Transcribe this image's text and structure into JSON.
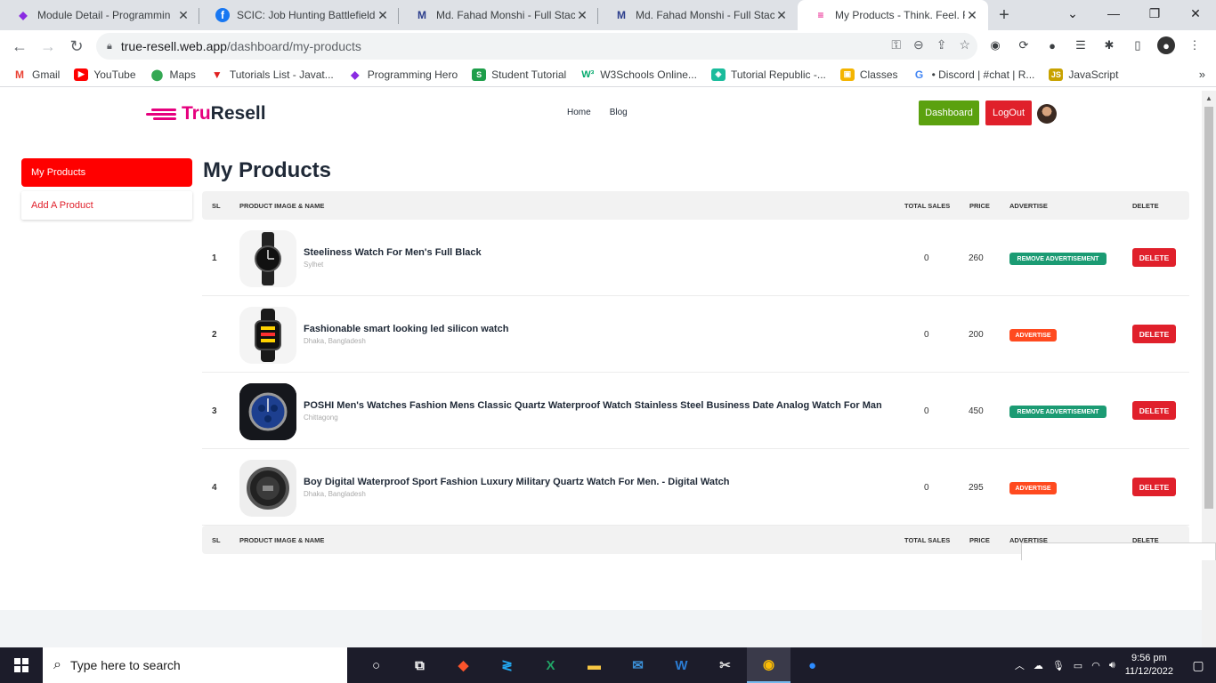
{
  "browser": {
    "tabs": [
      {
        "title": "Module Detail - Programmin",
        "favicon_color": "#8a2be2",
        "favicon": "◆",
        "active": false
      },
      {
        "title": "SCIC: Job Hunting Battlefield",
        "favicon_color": "#1877f2",
        "favicon": "f",
        "active": false
      },
      {
        "title": "Md. Fahad Monshi - Full Stac",
        "favicon_color": "#2c3e8c",
        "favicon": "M",
        "active": false
      },
      {
        "title": "Md. Fahad Monshi - Full Stac",
        "favicon_color": "#2c3e8c",
        "favicon": "M",
        "active": false
      },
      {
        "title": "My Products - Think. Feel. Re",
        "favicon_color": "#e6007e",
        "favicon": "≡",
        "active": true
      }
    ],
    "url_host": "true-resell.web.app",
    "url_path": "/dashboard/my-products",
    "bookmarks": [
      {
        "label": "Gmail",
        "icon_color": "#ea4335",
        "icon": "M"
      },
      {
        "label": "YouTube",
        "icon_color": "#ff0000",
        "icon": "▶"
      },
      {
        "label": "Maps",
        "icon_color": "#34a853",
        "icon": "●"
      },
      {
        "label": "Tutorials List - Javat...",
        "icon_color": "#e02020",
        "icon": "▼"
      },
      {
        "label": "Programming Hero",
        "icon_color": "#8a2be2",
        "icon": "◆"
      },
      {
        "label": "Student Tutorial",
        "icon_color": "#1e9e4a",
        "icon": "S"
      },
      {
        "label": "W3Schools Online...",
        "icon_color": "#04aa6d",
        "icon": "W"
      },
      {
        "label": "Tutorial Republic -...",
        "icon_color": "#1abc9c",
        "icon": "◈"
      },
      {
        "label": "Classes",
        "icon_color": "#f4b400",
        "icon": "▣"
      },
      {
        "label": "• Discord | #chat | R...",
        "icon_color": "#5865f2",
        "icon": "G"
      },
      {
        "label": "JavaScript",
        "icon_color": "#c8a200",
        "icon": "JS"
      }
    ]
  },
  "site": {
    "logo_prefix": "Tru",
    "logo_suffix": "Resell",
    "nav": [
      "Home",
      "Blog"
    ],
    "dashboard_label": "Dashboard",
    "logout_label": "LogOut"
  },
  "sidebar": {
    "items": [
      {
        "label": "My Products",
        "active": true
      },
      {
        "label": "Add A Product",
        "active": false
      }
    ]
  },
  "main": {
    "title": "My Products",
    "columns": [
      "SL",
      "PRODUCT IMAGE & NAME",
      "TOTAL SALES",
      "PRICE",
      "ADVERTISE",
      "DELETE"
    ],
    "rows": [
      {
        "sl": "1",
        "name": "Steeliness Watch For Men's Full Black",
        "location": "Sylhet",
        "sales": "0",
        "price": "260",
        "advertise": "REMOVE ADVERTISEMENT",
        "delete": "DELETE",
        "image": "analog-black-watch"
      },
      {
        "sl": "2",
        "name": "Fashionable smart looking led silicon watch",
        "location": "Dhaka, Bangladesh",
        "sales": "0",
        "price": "200",
        "advertise": "ADVERTISE",
        "delete": "DELETE",
        "image": "led-digital-watch"
      },
      {
        "sl": "3",
        "name": "POSHI Men's Watches Fashion Mens Classic Quartz Waterproof Watch Stainless Steel Business Date Analog Watch For Man",
        "location": "Chittagong",
        "sales": "0",
        "price": "450",
        "advertise": "REMOVE ADVERTISEMENT",
        "delete": "DELETE",
        "image": "blue-chronograph-watch"
      },
      {
        "sl": "4",
        "name": "Boy Digital Waterproof Sport Fashion Luxury Military Quartz Watch For Men. - Digital Watch",
        "location": "Dhaka, Bangladesh",
        "sales": "0",
        "price": "295",
        "advertise": "ADVERTISE",
        "delete": "DELETE",
        "image": "sport-digital-watch"
      }
    ]
  },
  "taskbar": {
    "search_placeholder": "Type here to search",
    "time": "9:56 pm",
    "date": "11/12/2022"
  },
  "colors": {
    "brand": "#e6007e",
    "primary_red": "#e0202b",
    "dashboard_green": "#5ba10f",
    "remove_ad_green": "#1b9b73",
    "advertise_orange": "#ff4a1f"
  }
}
